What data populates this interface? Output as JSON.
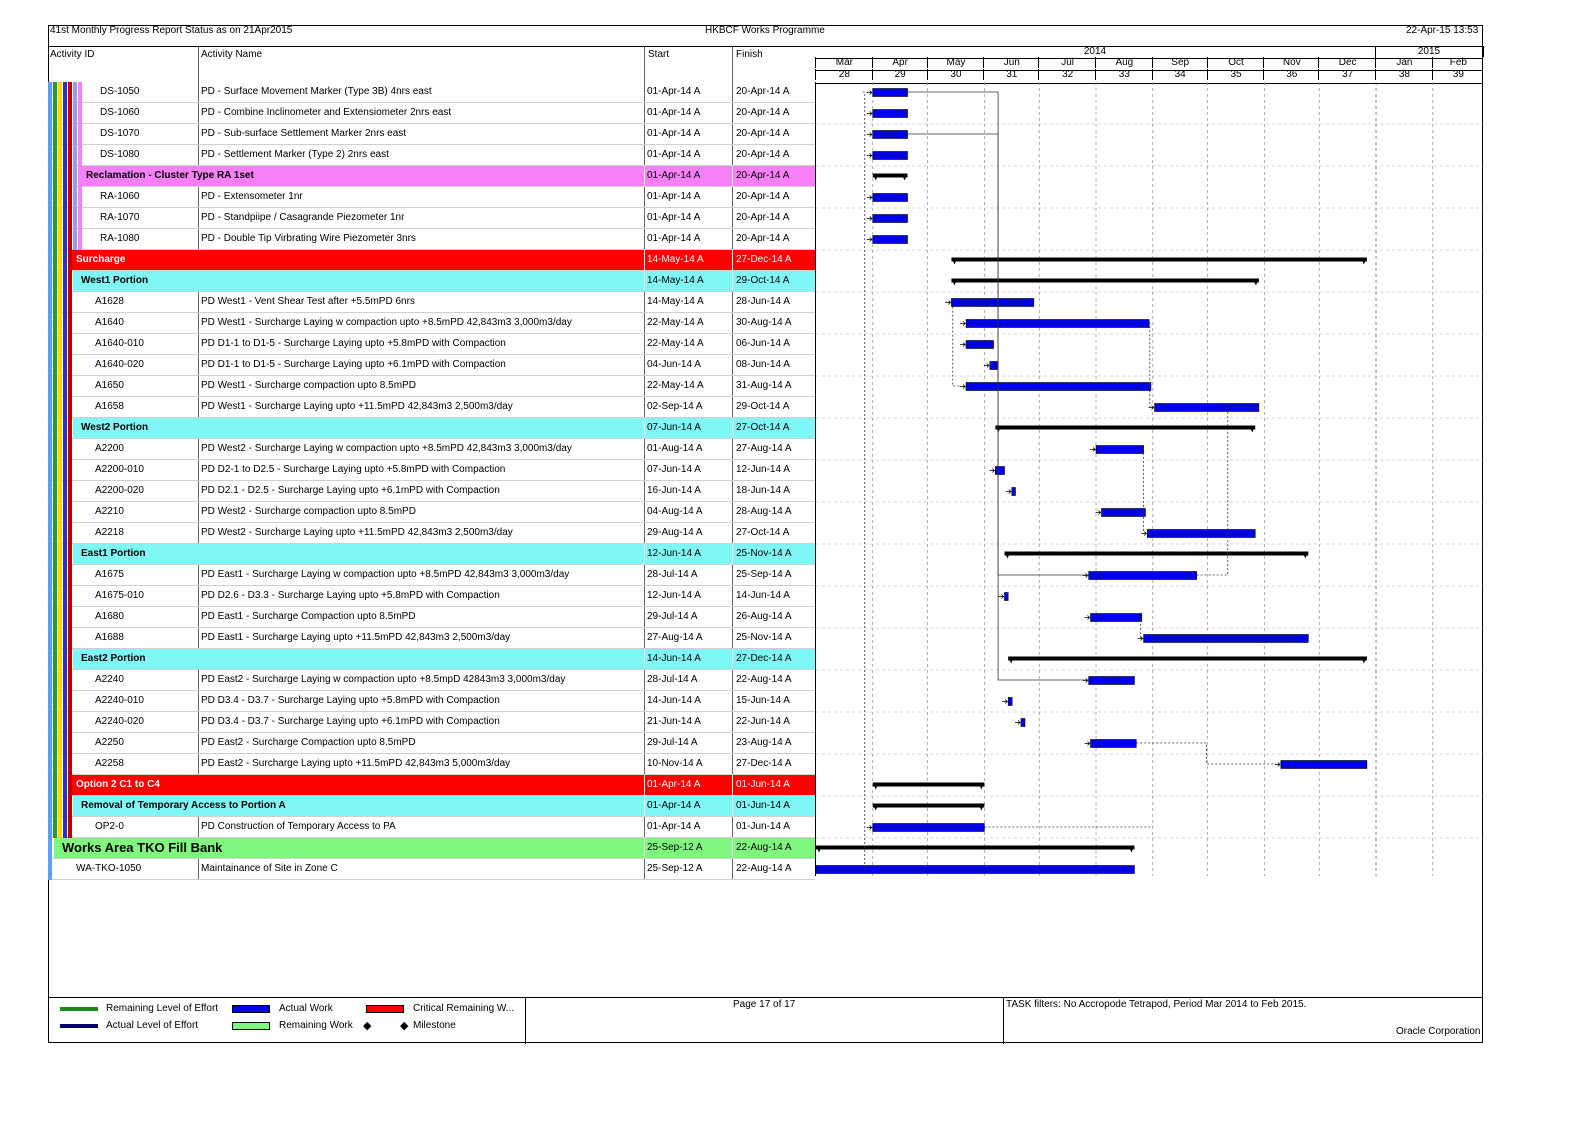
{
  "header": {
    "left": "41st Monthly Progress Report Status as on 21Apr2015",
    "center": "HKBCF Works Programme",
    "right": "22-Apr-15 13:53"
  },
  "columns": {
    "id": "Activity ID",
    "name": "Activity Name",
    "start": "Start",
    "finish": "Finish"
  },
  "timescale": {
    "years": [
      "2014",
      "2015"
    ],
    "months": [
      "Mar",
      "Apr",
      "May",
      "Jun",
      "Jul",
      "Aug",
      "Sep",
      "Oct",
      "Nov",
      "Dec",
      "Jan",
      "Feb"
    ],
    "weeks": [
      "28",
      "29",
      "30",
      "31",
      "32",
      "33",
      "34",
      "35",
      "36",
      "37",
      "38",
      "39"
    ]
  },
  "rows": [
    {
      "type": "act",
      "id": "DS-1050",
      "name": "PD - Surface Movement Marker (Type 3B) 4nrs east",
      "start": "01-Apr-14 A",
      "finish": "20-Apr-14 A",
      "bar": {
        "s": "2014-04-01",
        "f": "2014-04-20",
        "kind": "actual"
      }
    },
    {
      "type": "act",
      "id": "DS-1060",
      "name": "PD - Combine Inclinometer and Extensiometer 2nrs east",
      "start": "01-Apr-14 A",
      "finish": "20-Apr-14 A",
      "bar": {
        "s": "2014-04-01",
        "f": "2014-04-20",
        "kind": "actual"
      }
    },
    {
      "type": "act",
      "id": "DS-1070",
      "name": "PD - Sub-surface Settlement Marker 2nrs east",
      "start": "01-Apr-14 A",
      "finish": "20-Apr-14 A",
      "bar": {
        "s": "2014-04-01",
        "f": "2014-04-20",
        "kind": "actual"
      }
    },
    {
      "type": "act",
      "id": "DS-1080",
      "name": "PD - Settlement Marker (Type 2) 2nrs east",
      "start": "01-Apr-14 A",
      "finish": "20-Apr-14 A",
      "bar": {
        "s": "2014-04-01",
        "f": "2014-04-20",
        "kind": "actual"
      }
    },
    {
      "type": "wbs",
      "level": "pink",
      "id": "Reclamation - Cluster Type RA 1set",
      "name": "",
      "start": "01-Apr-14 A",
      "finish": "20-Apr-14 A",
      "bar": {
        "s": "2014-04-01",
        "f": "2014-04-20",
        "kind": "summary"
      }
    },
    {
      "type": "act",
      "id": "RA-1060",
      "name": "PD - Extensometer 1nr",
      "start": "01-Apr-14 A",
      "finish": "20-Apr-14 A",
      "bar": {
        "s": "2014-04-01",
        "f": "2014-04-20",
        "kind": "actual"
      }
    },
    {
      "type": "act",
      "id": "RA-1070",
      "name": "PD - Standpiipe / Casagrande Piezometer 1nr",
      "start": "01-Apr-14 A",
      "finish": "20-Apr-14 A",
      "bar": {
        "s": "2014-04-01",
        "f": "2014-04-20",
        "kind": "actual"
      }
    },
    {
      "type": "act",
      "id": "RA-1080",
      "name": "PD - Double Tip Virbrating Wire Piezometer 3nrs",
      "start": "01-Apr-14 A",
      "finish": "20-Apr-14 A",
      "bar": {
        "s": "2014-04-01",
        "f": "2014-04-20",
        "kind": "actual"
      }
    },
    {
      "type": "wbs",
      "level": "red",
      "id": "Surcharge",
      "name": "",
      "start": "14-May-14 A",
      "finish": "27-Dec-14 A",
      "bar": {
        "s": "2014-05-14",
        "f": "2014-12-27",
        "kind": "summary"
      }
    },
    {
      "type": "wbs",
      "level": "cyan",
      "id": "West1 Portion",
      "name": "",
      "start": "14-May-14 A",
      "finish": "29-Oct-14 A",
      "bar": {
        "s": "2014-05-14",
        "f": "2014-10-29",
        "kind": "summary"
      }
    },
    {
      "type": "act",
      "id": "A1628",
      "name": "PD West1 - Vent Shear Test after +5.5mPD 6nrs",
      "start": "14-May-14 A",
      "finish": "28-Jun-14 A",
      "bar": {
        "s": "2014-05-14",
        "f": "2014-06-28",
        "kind": "actual"
      }
    },
    {
      "type": "act",
      "id": "A1640",
      "name": "PD West1 - Surcharge Laying w compaction upto +8.5mPD 42,843m3 3,000m3/day",
      "start": "22-May-14 A",
      "finish": "30-Aug-14 A",
      "bar": {
        "s": "2014-05-22",
        "f": "2014-08-30",
        "kind": "actual"
      }
    },
    {
      "type": "act",
      "id": "A1640-010",
      "name": "PD D1-1 to D1-5 - Surcharge Laying upto +5.8mPD with Compaction",
      "start": "22-May-14 A",
      "finish": "06-Jun-14 A",
      "bar": {
        "s": "2014-05-22",
        "f": "2014-06-06",
        "kind": "actual"
      }
    },
    {
      "type": "act",
      "id": "A1640-020",
      "name": "PD D1-1 to D1-5 - Surcharge Laying upto +6.1mPD with Compaction",
      "start": "04-Jun-14 A",
      "finish": "08-Jun-14 A",
      "bar": {
        "s": "2014-06-04",
        "f": "2014-06-08",
        "kind": "actual"
      }
    },
    {
      "type": "act",
      "id": "A1650",
      "name": "PD West1 - Surcharge compaction upto 8.5mPD",
      "start": "22-May-14 A",
      "finish": "31-Aug-14 A",
      "bar": {
        "s": "2014-05-22",
        "f": "2014-08-31",
        "kind": "actual"
      }
    },
    {
      "type": "act",
      "id": "A1658",
      "name": "PD West1 - Surcharge Laying upto +11.5mPD 42,843m3 2,500m3/day",
      "start": "02-Sep-14 A",
      "finish": "29-Oct-14 A",
      "bar": {
        "s": "2014-09-02",
        "f": "2014-10-29",
        "kind": "actual"
      }
    },
    {
      "type": "wbs",
      "level": "cyan",
      "id": "West2 Portion",
      "name": "",
      "start": "07-Jun-14 A",
      "finish": "27-Oct-14 A",
      "bar": {
        "s": "2014-06-07",
        "f": "2014-10-27",
        "kind": "summary"
      }
    },
    {
      "type": "act",
      "id": "A2200",
      "name": "PD West2 - Surcharge Laying w compaction upto +8.5mPD 42,843m3 3,000m3/day",
      "start": "01-Aug-14 A",
      "finish": "27-Aug-14 A",
      "bar": {
        "s": "2014-08-01",
        "f": "2014-08-27",
        "kind": "actual"
      }
    },
    {
      "type": "act",
      "id": "A2200-010",
      "name": "PD D2-1 to D2.5 - Surcharge Laying upto +5.8mPD with Compaction",
      "start": "07-Jun-14 A",
      "finish": "12-Jun-14 A",
      "bar": {
        "s": "2014-06-07",
        "f": "2014-06-12",
        "kind": "actual"
      }
    },
    {
      "type": "act",
      "id": "A2200-020",
      "name": "PD D2.1 - D2.5 - Surcharge Laying upto +6.1mPD with Compaction",
      "start": "16-Jun-14 A",
      "finish": "18-Jun-14 A",
      "bar": {
        "s": "2014-06-16",
        "f": "2014-06-18",
        "kind": "actual"
      }
    },
    {
      "type": "act",
      "id": "A2210",
      "name": "PD West2 - Surcharge compaction upto 8.5mPD",
      "start": "04-Aug-14 A",
      "finish": "28-Aug-14 A",
      "bar": {
        "s": "2014-08-04",
        "f": "2014-08-28",
        "kind": "actual"
      }
    },
    {
      "type": "act",
      "id": "A2218",
      "name": "PD West2 - Surcharge Laying upto +11.5mPD 42,843m3 2,500m3/day",
      "start": "29-Aug-14 A",
      "finish": "27-Oct-14 A",
      "bar": {
        "s": "2014-08-29",
        "f": "2014-10-27",
        "kind": "actual"
      }
    },
    {
      "type": "wbs",
      "level": "cyan",
      "id": "East1 Portion",
      "name": "",
      "start": "12-Jun-14 A",
      "finish": "25-Nov-14 A",
      "bar": {
        "s": "2014-06-12",
        "f": "2014-11-25",
        "kind": "summary"
      }
    },
    {
      "type": "act",
      "id": "A1675",
      "name": "PD East1 - Surcharge Laying w compaction upto +8.5mPD 42,843m3 3,000m3/day",
      "start": "28-Jul-14 A",
      "finish": "25-Sep-14 A",
      "bar": {
        "s": "2014-07-28",
        "f": "2014-09-25",
        "kind": "actual"
      }
    },
    {
      "type": "act",
      "id": "A1675-010",
      "name": "PD D2.6 - D3.3 - Surcharge Laying upto +5.8mPD with Compaction",
      "start": "12-Jun-14 A",
      "finish": "14-Jun-14 A",
      "bar": {
        "s": "2014-06-12",
        "f": "2014-06-14",
        "kind": "actual"
      }
    },
    {
      "type": "act",
      "id": "A1680",
      "name": "PD East1 - Surcharge Compaction upto 8.5mPD",
      "start": "29-Jul-14 A",
      "finish": "26-Aug-14 A",
      "bar": {
        "s": "2014-07-29",
        "f": "2014-08-26",
        "kind": "actual"
      }
    },
    {
      "type": "act",
      "id": "A1688",
      "name": "PD East1 - Surcharge Laying upto +11.5mPD 42,843m3 2,500m3/day",
      "start": "27-Aug-14 A",
      "finish": "25-Nov-14 A",
      "bar": {
        "s": "2014-08-27",
        "f": "2014-11-25",
        "kind": "actual"
      }
    },
    {
      "type": "wbs",
      "level": "cyan",
      "id": "East2 Portion",
      "name": "",
      "start": "14-Jun-14 A",
      "finish": "27-Dec-14 A",
      "bar": {
        "s": "2014-06-14",
        "f": "2014-12-27",
        "kind": "summary"
      }
    },
    {
      "type": "act",
      "id": "A2240",
      "name": "PD East2 - Surcharge Laying w compaction upto +8.5mpD 42843m3 3,000m3/day",
      "start": "28-Jul-14 A",
      "finish": "22-Aug-14 A",
      "bar": {
        "s": "2014-07-28",
        "f": "2014-08-22",
        "kind": "actual"
      }
    },
    {
      "type": "act",
      "id": "A2240-010",
      "name": "PD D3.4 - D3.7 - Surcharge Laying upto +5.8mPD with Compaction",
      "start": "14-Jun-14 A",
      "finish": "15-Jun-14 A",
      "bar": {
        "s": "2014-06-14",
        "f": "2014-06-15",
        "kind": "actual"
      }
    },
    {
      "type": "act",
      "id": "A2240-020",
      "name": "PD D3.4 - D3.7 - Surcharge Laying upto +6.1mPD with Compaction",
      "start": "21-Jun-14 A",
      "finish": "22-Jun-14 A",
      "bar": {
        "s": "2014-06-21",
        "f": "2014-06-22",
        "kind": "actual"
      }
    },
    {
      "type": "act",
      "id": "A2250",
      "name": "PD East2 - Surcharge Compaction upto 8.5mPD",
      "start": "29-Jul-14 A",
      "finish": "23-Aug-14 A",
      "bar": {
        "s": "2014-07-29",
        "f": "2014-08-23",
        "kind": "actual"
      }
    },
    {
      "type": "act",
      "id": "A2258",
      "name": "PD East2 - Surcharge Laying upto +11.5mPD 42,843m3 5,000m3/day",
      "start": "10-Nov-14 A",
      "finish": "27-Dec-14 A",
      "bar": {
        "s": "2014-11-10",
        "f": "2014-12-27",
        "kind": "actual"
      }
    },
    {
      "type": "wbs",
      "level": "red",
      "id": "Option 2 C1 to C4",
      "name": "",
      "start": "01-Apr-14 A",
      "finish": "01-Jun-14 A",
      "bar": {
        "s": "2014-04-01",
        "f": "2014-06-01",
        "kind": "summary"
      }
    },
    {
      "type": "wbs",
      "level": "cyan",
      "id": "Removal of Temporary Access to Portion A",
      "name": "",
      "start": "01-Apr-14 A",
      "finish": "01-Jun-14 A",
      "bar": {
        "s": "2014-04-01",
        "f": "2014-06-01",
        "kind": "summary"
      }
    },
    {
      "type": "act",
      "id": "OP2-0",
      "name": "PD Construction of Temporary Access to PA",
      "start": "01-Apr-14 A",
      "finish": "01-Jun-14 A",
      "bar": {
        "s": "2014-04-01",
        "f": "2014-06-01",
        "kind": "actual"
      }
    },
    {
      "type": "wbs",
      "level": "green",
      "id": "Works Area TKO Fill Bank",
      "name": "",
      "start": "25-Sep-12 A",
      "finish": "22-Aug-14 A",
      "bar": {
        "s": "2014-02-28",
        "f": "2014-08-22",
        "kind": "summary"
      }
    },
    {
      "type": "act",
      "id": "WA-TKO-1050",
      "name": "Maintainance of Site in Zone C",
      "start": "25-Sep-12 A",
      "finish": "22-Aug-14 A",
      "bar": {
        "s": "2014-02-28",
        "f": "2014-08-22",
        "kind": "actual"
      }
    }
  ],
  "colors": {
    "pink": "#f77ff7",
    "red": "#ff0000",
    "cyan": "#7ff7f7",
    "green": "#7ff77f",
    "actual": "#0000e6",
    "summary": "#000000"
  },
  "legend": {
    "rloe": "Remaining Level of Effort",
    "aloe": "Actual Level of Effort",
    "actual": "Actual Work",
    "remaining": "Remaining Work",
    "critical": "Critical Remaining W...",
    "milestone": "Milestone"
  },
  "footer": {
    "page": "Page 17 of 17",
    "filters": "TASK filters: No Accropode Tetrapod, Period Mar 2014 to Feb 2015.",
    "company": "Oracle Corporation"
  }
}
